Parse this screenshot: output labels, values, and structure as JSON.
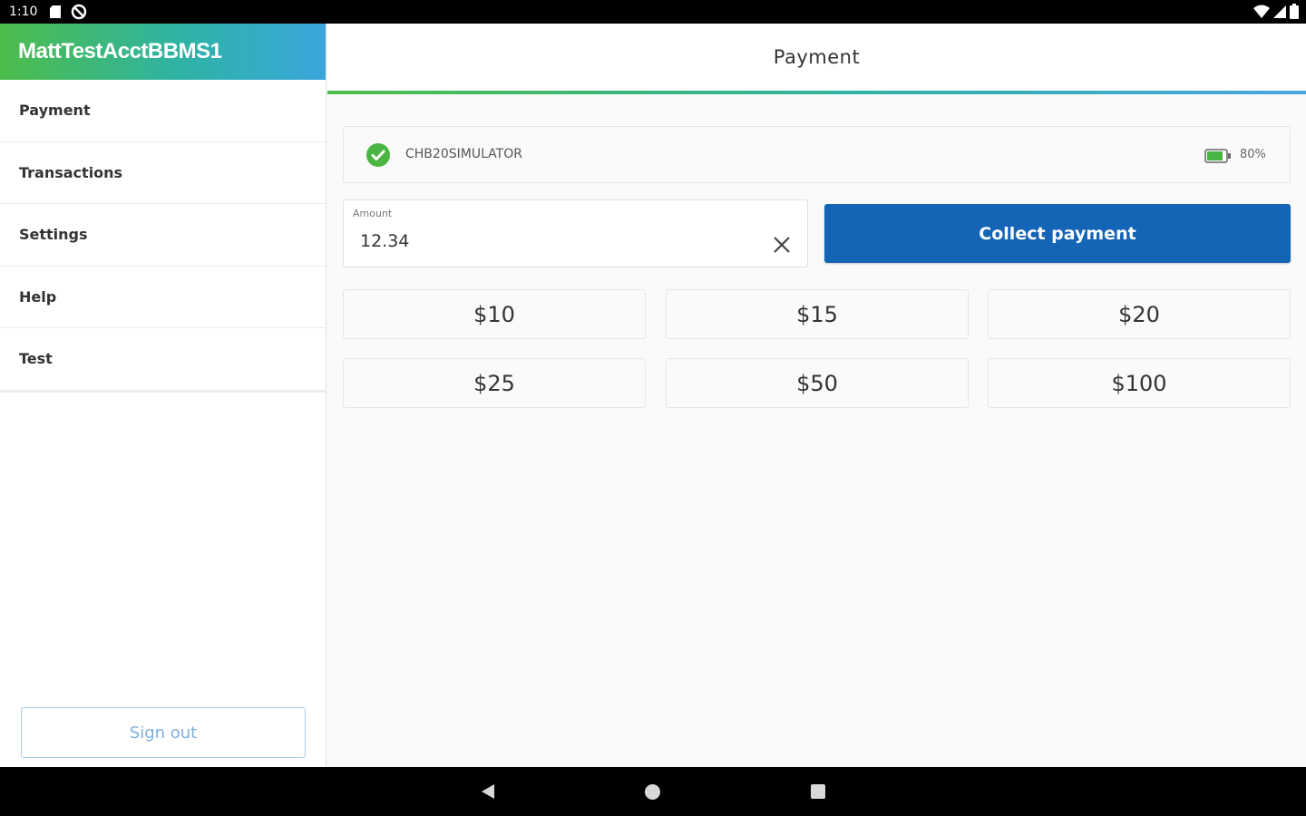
{
  "status_bar": {
    "time": "1:10"
  },
  "sidebar": {
    "account_name": "MattTestAcctBBMS1",
    "items": [
      {
        "label": "Payment"
      },
      {
        "label": "Transactions"
      },
      {
        "label": "Settings"
      },
      {
        "label": "Help"
      },
      {
        "label": "Test"
      }
    ],
    "sign_out_label": "Sign out"
  },
  "main": {
    "title": "Payment",
    "device": {
      "name": "CHB20SIMULATOR",
      "battery": "80%"
    },
    "amount": {
      "label": "Amount",
      "value": "12.34"
    },
    "collect_label": "Collect payment",
    "quick_amounts": [
      {
        "label": "$10"
      },
      {
        "label": "$15"
      },
      {
        "label": "$20"
      },
      {
        "label": "$25"
      },
      {
        "label": "$50"
      },
      {
        "label": "$100"
      }
    ]
  },
  "colors": {
    "accent_green": "#4dbd4a",
    "accent_blue": "#3aa6dc",
    "primary_button": "#1565b7",
    "check_green": "#4bb543"
  },
  "icons": {
    "device_status": "check-circle-icon",
    "battery": "battery-icon",
    "clear": "close-icon",
    "nav_back": "back-triangle-icon",
    "nav_home": "home-circle-icon",
    "nav_recents": "recents-square-icon"
  }
}
